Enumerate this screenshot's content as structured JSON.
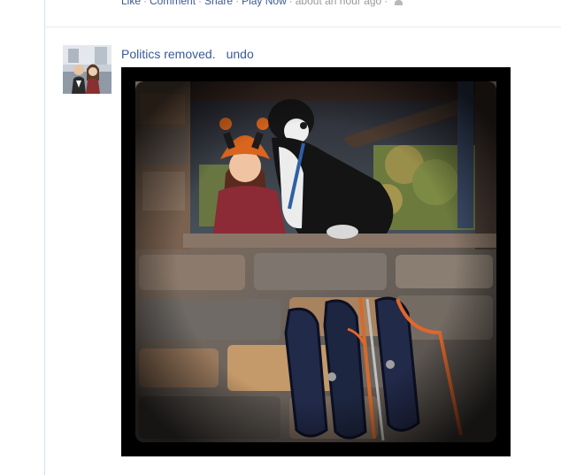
{
  "previous_post": {
    "actions": [
      "Like",
      "Comment",
      "Share",
      "Play Now"
    ],
    "timestamp": "about an hour ago",
    "audience_icon": "friends-icon"
  },
  "story": {
    "avatar_icon": "profile-avatar",
    "status_text": "Politics removed.",
    "undo_label": "undo",
    "photo_icon": "photo-dog-snowshoes"
  },
  "colors": {
    "link": "#3b5998",
    "meta": "#999999",
    "rule": "#d8dfea"
  }
}
